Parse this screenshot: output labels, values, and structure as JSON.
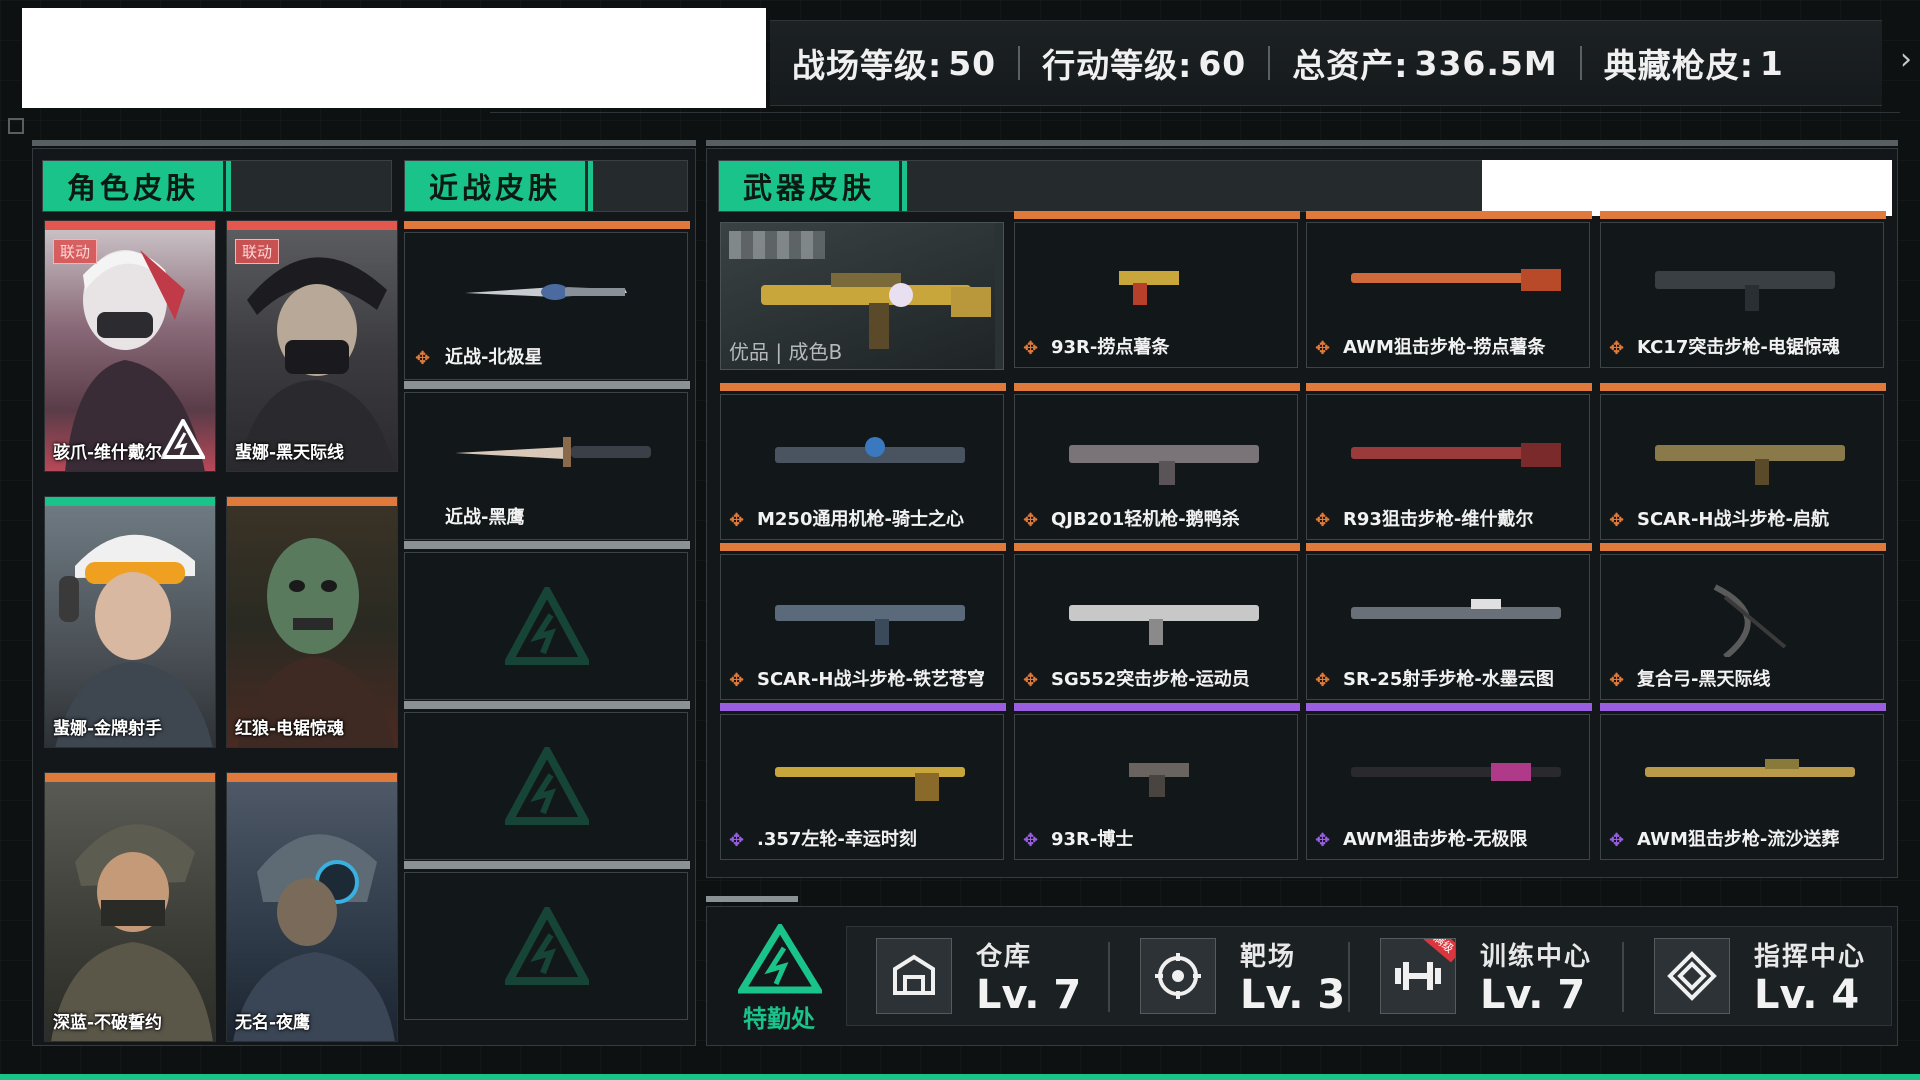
{
  "header": {
    "stats": [
      {
        "label": "战场等级:",
        "value": "50"
      },
      {
        "label": "行动等级:",
        "value": "60"
      },
      {
        "label": "总资产:",
        "value": "336.5M"
      },
      {
        "label": "典藏枪皮:",
        "value": "1"
      }
    ],
    "arrow_icon": "chevron-right-icon"
  },
  "sections": {
    "character": "角色皮肤",
    "melee": "近战皮肤",
    "weapon": "武器皮肤"
  },
  "character_skins": [
    {
      "name": "骇爪-维什戴尔",
      "badge": "联动",
      "bar": "#e4574f"
    },
    {
      "name": "蜚娜-黑天际线",
      "badge": "联动",
      "bar": "#e4574f"
    },
    {
      "name": "蜚娜-金牌射手",
      "badge": "",
      "bar": "#19c38a"
    },
    {
      "name": "红狼-电锯惊魂",
      "badge": "",
      "bar": "#e07a3c"
    },
    {
      "name": "深蓝-不破誓约",
      "badge": "",
      "bar": "#e07a3c"
    },
    {
      "name": "无名-夜鹰",
      "badge": "",
      "bar": "#e07a3c"
    }
  ],
  "melee_skins": [
    {
      "name": "近战-北极星",
      "bar": "#e07a3c",
      "rarity_icon": "orange-rarity-icon"
    },
    {
      "name": "近战-黑鹰",
      "bar": "#8b9294",
      "rarity_icon": ""
    },
    {
      "name": "",
      "bar": "#8b9294",
      "rarity_icon": ""
    },
    {
      "name": "",
      "bar": "#8b9294",
      "rarity_icon": ""
    },
    {
      "name": "",
      "bar": "#8b9294",
      "rarity_icon": ""
    }
  ],
  "weapon_featured": {
    "quality": "优品 | 成色B"
  },
  "weapon_skins": [
    {
      "name": "93R-捞点薯条",
      "bar": "#e07a3c",
      "rarity": "orange"
    },
    {
      "name": "AWM狙击步枪-捞点薯条",
      "bar": "#e07a3c",
      "rarity": "orange"
    },
    {
      "name": "KC17突击步枪-电锯惊魂",
      "bar": "#e07a3c",
      "rarity": "orange"
    },
    {
      "name": "M250通用机枪-骑士之心",
      "bar": "#e07a3c",
      "rarity": "orange"
    },
    {
      "name": "QJB201轻机枪-鹅鸭杀",
      "bar": "#e07a3c",
      "rarity": "orange"
    },
    {
      "name": "R93狙击步枪-维什戴尔",
      "bar": "#e07a3c",
      "rarity": "orange"
    },
    {
      "name": "SCAR-H战斗步枪-启航",
      "bar": "#e07a3c",
      "rarity": "orange"
    },
    {
      "name": "SCAR-H战斗步枪-铁艺苍穹",
      "bar": "#e07a3c",
      "rarity": "orange"
    },
    {
      "name": "SG552突击步枪-运动员",
      "bar": "#e07a3c",
      "rarity": "orange"
    },
    {
      "name": "SR-25射手步枪-水墨云图",
      "bar": "#e07a3c",
      "rarity": "orange"
    },
    {
      "name": "复合弓-黑天际线",
      "bar": "#e07a3c",
      "rarity": "orange"
    },
    {
      "name": ".357左轮-幸运时刻",
      "bar": "#9a5fe0",
      "rarity": "purple"
    },
    {
      "name": "93R-博士",
      "bar": "#9a5fe0",
      "rarity": "purple"
    },
    {
      "name": "AWM狙击步枪-无极限",
      "bar": "#9a5fe0",
      "rarity": "purple"
    },
    {
      "name": "AWM狙击步枪-流沙送葬",
      "bar": "#9a5fe0",
      "rarity": "purple"
    }
  ],
  "headquarters": {
    "label": "特勤处"
  },
  "facilities": [
    {
      "name": "仓库",
      "level": "Lv. 7",
      "icon": "warehouse-icon",
      "max": false
    },
    {
      "name": "靶场",
      "level": "Lv. 3",
      "icon": "target-icon",
      "max": false
    },
    {
      "name": "训练中心",
      "level": "Lv. 7",
      "icon": "dumbbell-icon",
      "max": true,
      "max_label": "满级"
    },
    {
      "name": "指挥中心",
      "level": "Lv. 4",
      "icon": "command-icon",
      "max": false
    }
  ],
  "colors": {
    "accent": "#19c38a",
    "orange": "#e07a3c",
    "purple": "#9a5fe0",
    "red": "#e4574f"
  }
}
